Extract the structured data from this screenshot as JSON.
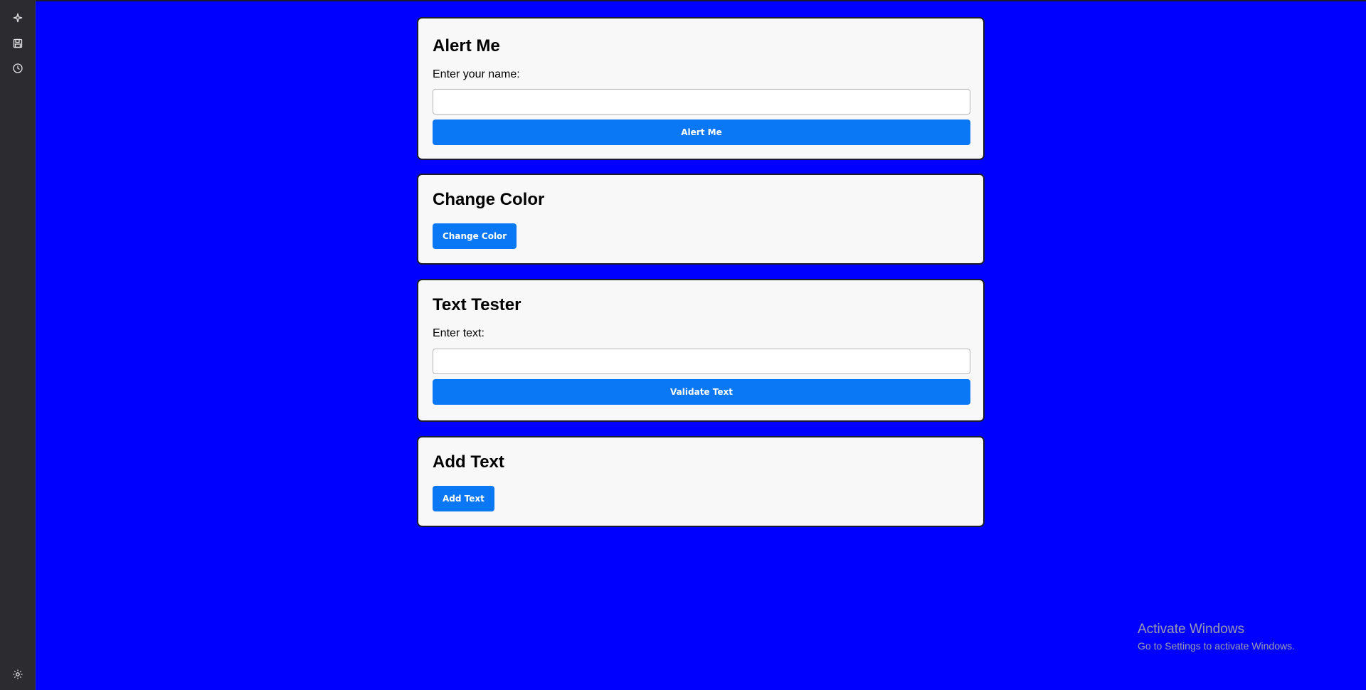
{
  "sidebar": {
    "icons": [
      {
        "name": "sparkle-icon"
      },
      {
        "name": "save-icon"
      },
      {
        "name": "history-icon"
      },
      {
        "name": "settings-icon"
      }
    ]
  },
  "cards": {
    "alert": {
      "title": "Alert Me",
      "label": "Enter your name:",
      "input_value": "",
      "button_label": "Alert Me"
    },
    "color": {
      "title": "Change Color",
      "button_label": "Change Color"
    },
    "text_tester": {
      "title": "Text Tester",
      "label": "Enter text:",
      "input_value": "",
      "button_label": "Validate Text"
    },
    "add_text": {
      "title": "Add Text",
      "button_label": "Add Text"
    }
  },
  "watermark": {
    "title": "Activate Windows",
    "subtitle": "Go to Settings to activate Windows."
  },
  "colors": {
    "page_background": "#0000ff",
    "sidebar_background": "#2b2b30",
    "card_background": "#f8f8f8",
    "button_primary": "#0a78f5"
  }
}
